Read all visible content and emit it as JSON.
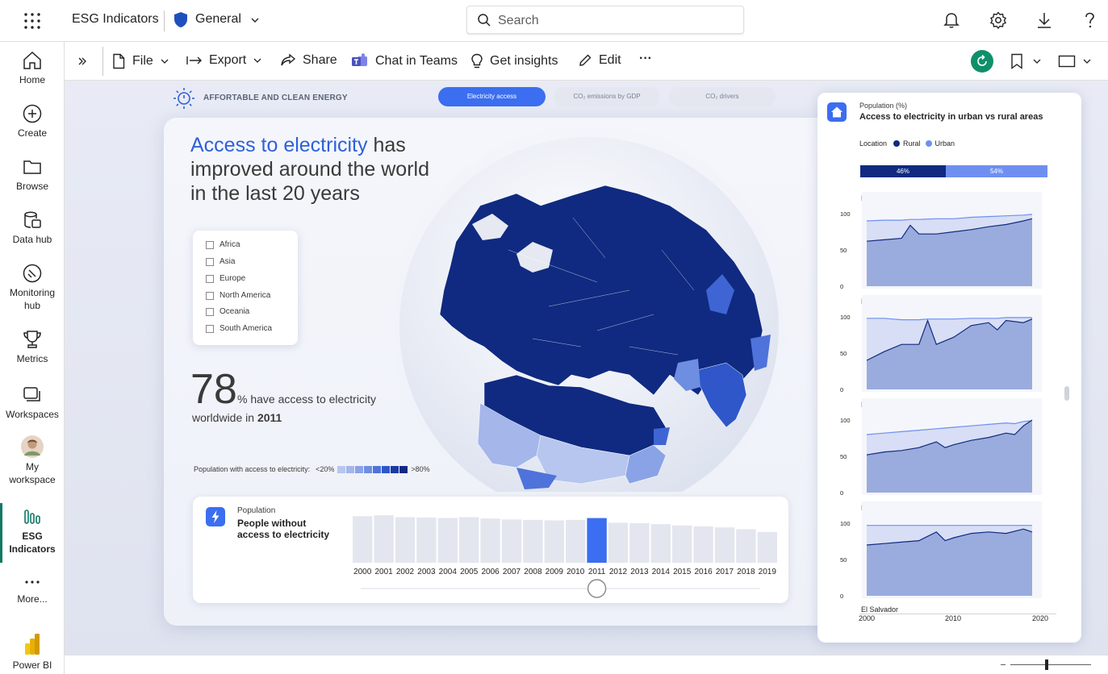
{
  "header": {
    "app_title": "ESG Indicators",
    "workspace": "General",
    "search_placeholder": "Search"
  },
  "nav": {
    "items": [
      {
        "label": "Home"
      },
      {
        "label": "Create"
      },
      {
        "label": "Browse"
      },
      {
        "label": "Data hub"
      },
      {
        "label": "Monitoring",
        "label2": "hub"
      },
      {
        "label": "Metrics"
      },
      {
        "label": "Workspaces"
      },
      {
        "label": "My",
        "label2": "workspace"
      },
      {
        "label": "ESG",
        "label2": "Indicators"
      },
      {
        "label": "More..."
      },
      {
        "label": "Power BI"
      }
    ]
  },
  "toolbar": {
    "file": "File",
    "export": "Export",
    "share": "Share",
    "chat": "Chat in Teams",
    "insights": "Get insights",
    "edit": "Edit",
    "more": "···"
  },
  "report": {
    "section_title": "AFFORTABLE AND CLEAN ENERGY",
    "tabs": [
      "Electricity access",
      "CO₂ emissions by GDP",
      "CO₂ drivers"
    ],
    "headline_highlight": "Access to electricity",
    "headline_line1_rest": " has",
    "headline_line2": "improved around the world",
    "headline_line3": "in the last 20 years",
    "regions": [
      "Africa",
      "Asia",
      "Europe",
      "North America",
      "Oceania",
      "South America"
    ],
    "stat_value": "78",
    "stat_text": "% have access to electricity",
    "stat_text2_prefix": "worldwide in ",
    "stat_year": "2011",
    "legend_label": "Population with access to electricity:",
    "legend_low": "<20%",
    "legend_high": ">80%",
    "legend_colors": [
      "#b7c6ee",
      "#a4b6ea",
      "#8aa3e6",
      "#6e8ee2",
      "#4f73da",
      "#2f57c9",
      "#1a3aa6",
      "#0f2a80"
    ],
    "colors": {
      "accent": "#2f60d8",
      "dark_navy": "#0f2a80",
      "bar_light": "#e3e6ee",
      "bar_active": "#3b6ef0"
    }
  },
  "people_card": {
    "subtitle": "Population",
    "title_line1": "People without",
    "title_line2": "access to electricity",
    "years": [
      "2000",
      "2001",
      "2002",
      "2003",
      "2004",
      "2005",
      "2006",
      "2007",
      "2008",
      "2009",
      "2010",
      "2011",
      "2012",
      "2013",
      "2014",
      "2015",
      "2016",
      "2017",
      "2018",
      "2019"
    ],
    "selected_year": "2011"
  },
  "side_card": {
    "subtitle": "Population (%)",
    "title": "Access to electricity in urban vs rural areas",
    "legend_title": "Location",
    "legend": [
      {
        "name": "Rural",
        "color": "#0f2a80"
      },
      {
        "name": "Urban",
        "color": "#6f8ff0"
      }
    ],
    "split_rural": "46%",
    "split_urban": "54%",
    "y_ticks": [
      "100",
      "50",
      "0"
    ],
    "x_ticks": [
      "2000",
      "2010",
      "2020"
    ],
    "partial_label": "El Salvador"
  },
  "chart_data": [
    {
      "type": "bar",
      "categories": [
        "2000",
        "2001",
        "2002",
        "2003",
        "2004",
        "2005",
        "2006",
        "2007",
        "2008",
        "2009",
        "2010",
        "2011",
        "2012",
        "2013",
        "2014",
        "2015",
        "2016",
        "2017",
        "2018",
        "2019"
      ],
      "values": [
        1.0,
        1.02,
        0.98,
        0.97,
        0.96,
        0.98,
        0.95,
        0.93,
        0.92,
        0.91,
        0.92,
        0.96,
        0.86,
        0.85,
        0.83,
        0.8,
        0.78,
        0.76,
        0.72,
        0.66
      ],
      "selected": "2011"
    },
    {
      "type": "area",
      "title": "Philippines",
      "x": [
        2000,
        2002,
        2004,
        2005,
        2006,
        2008,
        2010,
        2012,
        2014,
        2016,
        2018,
        2019
      ],
      "series": [
        {
          "name": "Urban",
          "values": [
            90,
            91,
            91,
            92,
            92,
            93,
            93,
            95,
            96,
            97,
            98,
            99
          ]
        },
        {
          "name": "Rural",
          "values": [
            62,
            64,
            66,
            84,
            72,
            72,
            75,
            78,
            82,
            85,
            90,
            93
          ]
        }
      ],
      "ylim": [
        0,
        100
      ]
    },
    {
      "type": "area",
      "title": "Morocco",
      "x": [
        2000,
        2002,
        2004,
        2006,
        2007,
        2008,
        2010,
        2012,
        2014,
        2015,
        2016,
        2018,
        2019
      ],
      "series": [
        {
          "name": "Urban",
          "values": [
            98,
            98,
            96,
            96,
            97,
            97,
            97,
            98,
            98,
            98,
            99,
            99,
            99
          ]
        },
        {
          "name": "Rural",
          "values": [
            40,
            52,
            62,
            62,
            95,
            62,
            72,
            88,
            92,
            82,
            95,
            92,
            97
          ]
        }
      ],
      "ylim": [
        0,
        100
      ]
    },
    {
      "type": "area",
      "title": "Fiji",
      "x": [
        2000,
        2002,
        2004,
        2006,
        2008,
        2009,
        2010,
        2012,
        2014,
        2016,
        2017,
        2018,
        2019
      ],
      "series": [
        {
          "name": "Urban",
          "values": [
            80,
            82,
            84,
            86,
            88,
            89,
            90,
            92,
            94,
            96,
            95,
            98,
            99
          ]
        },
        {
          "name": "Rural",
          "values": [
            52,
            56,
            58,
            62,
            70,
            62,
            66,
            72,
            76,
            82,
            80,
            92,
            100
          ]
        }
      ],
      "ylim": [
        0,
        100
      ]
    },
    {
      "type": "area",
      "title": "Belize",
      "x": [
        2000,
        2002,
        2004,
        2006,
        2008,
        2009,
        2010,
        2012,
        2014,
        2016,
        2018,
        2019
      ],
      "series": [
        {
          "name": "Urban",
          "values": [
            97,
            97,
            97,
            97,
            97,
            97,
            97,
            97,
            97,
            97,
            97,
            97
          ]
        },
        {
          "name": "Rural",
          "values": [
            70,
            72,
            74,
            76,
            88,
            76,
            80,
            86,
            88,
            86,
            92,
            88
          ]
        }
      ],
      "ylim": [
        0,
        100
      ]
    }
  ]
}
